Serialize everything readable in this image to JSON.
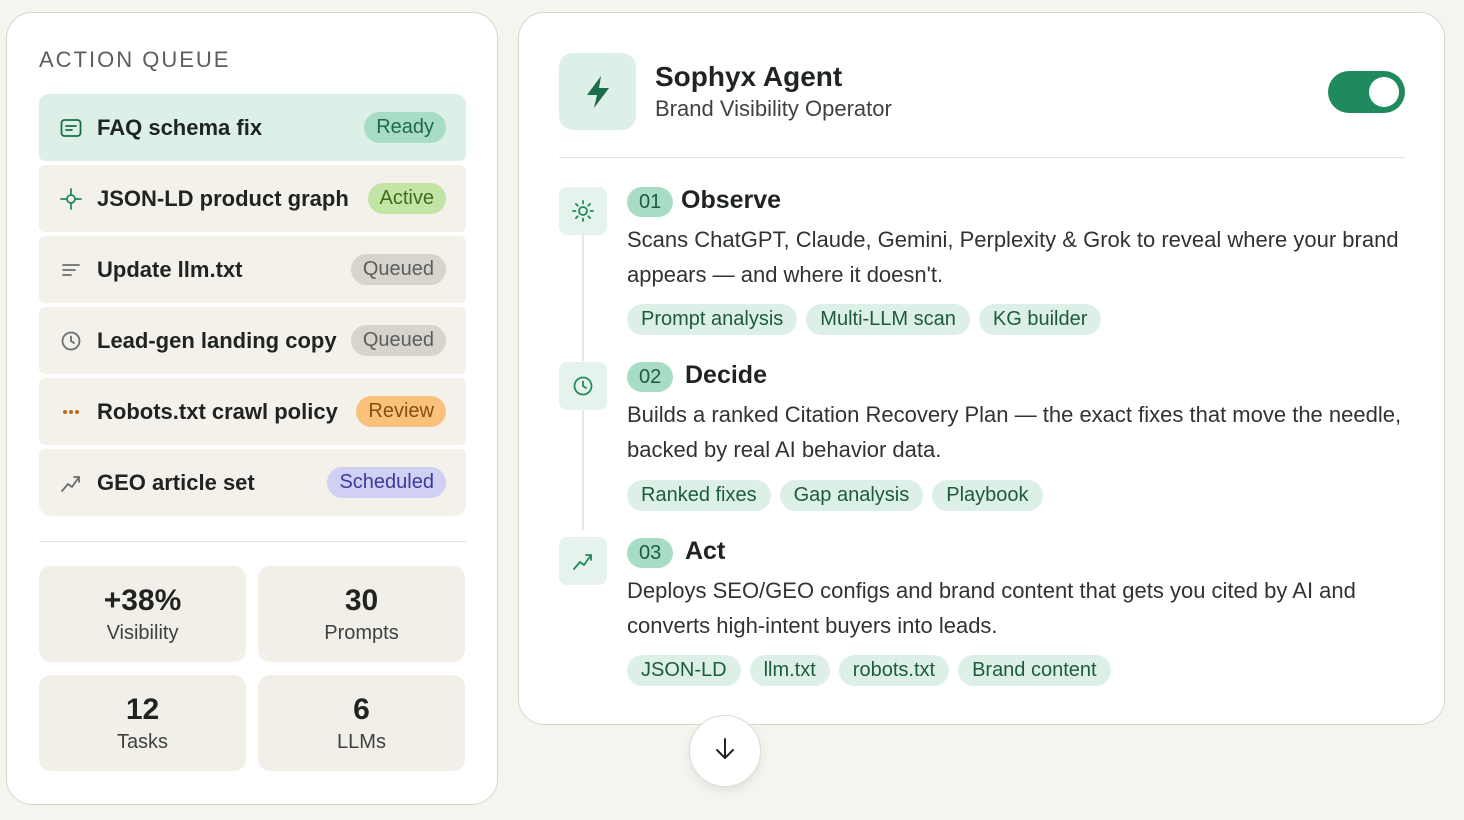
{
  "action_queue": {
    "title": "ACTION QUEUE",
    "items": [
      {
        "label": "FAQ schema fix",
        "status": "Ready",
        "icon": "faq-doc-icon"
      },
      {
        "label": "JSON-LD product graph",
        "status": "Active",
        "icon": "crosshair-icon"
      },
      {
        "label": "Update llm.txt",
        "status": "Queued",
        "icon": "text-lines-icon"
      },
      {
        "label": "Lead-gen landing copy",
        "status": "Queued",
        "icon": "clock-icon"
      },
      {
        "label": "Robots.txt crawl policy",
        "status": "Review",
        "icon": "more-dots-icon"
      },
      {
        "label": "GEO article set",
        "status": "Scheduled",
        "icon": "trend-icon"
      }
    ],
    "status_colors": {
      "Ready": "#a9dcc4",
      "Active": "#c2e5a5",
      "Queued": "#d6d4cc",
      "Review": "#f8c27c",
      "Scheduled": "#cfd0f3"
    }
  },
  "stats": [
    {
      "value": "+38%",
      "label": "Visibility"
    },
    {
      "value": "30",
      "label": "Prompts"
    },
    {
      "value": "12",
      "label": "Tasks"
    },
    {
      "value": "6",
      "label": "LLMs"
    }
  ],
  "agent": {
    "name": "Sophyx Agent",
    "role": "Brand Visibility Operator",
    "icon": "lightning-icon",
    "enabled": true,
    "accent": "#1f8a5d"
  },
  "steps": [
    {
      "num": "01",
      "title": "Observe",
      "icon": "sun-icon",
      "description": "Scans ChatGPT, Claude, Gemini, Perplexity & Grok to reveal where your brand appears — and where it doesn't.",
      "tags": [
        "Prompt analysis",
        "Multi-LLM scan",
        "KG builder"
      ]
    },
    {
      "num": "02",
      "title": "Decide",
      "icon": "clock-icon",
      "description": "Builds a ranked Citation Recovery Plan — the exact fixes that move the needle, backed by real AI behavior data.",
      "tags": [
        "Ranked fixes",
        "Gap analysis",
        "Playbook"
      ]
    },
    {
      "num": "03",
      "title": "Act",
      "icon": "trend-icon",
      "description": "Deploys SEO/GEO configs and brand content that gets you cited by AI and converts high-intent buyers into leads.",
      "tags": [
        "JSON-LD",
        "llm.txt",
        "robots.txt",
        "Brand content"
      ]
    }
  ],
  "scroll_button": {
    "icon": "arrow-down-icon"
  }
}
